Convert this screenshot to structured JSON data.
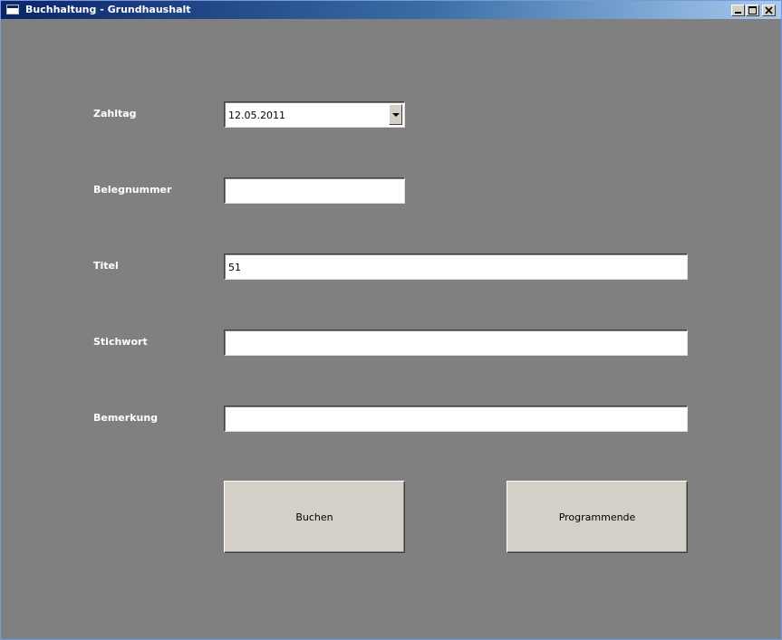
{
  "window": {
    "title": "Buchhaltung - Grundhaushalt"
  },
  "form": {
    "zahltag": {
      "label": "Zahltag",
      "value": "12.05.2011"
    },
    "belegnummer": {
      "label": "Belegnummer",
      "value": ""
    },
    "titel": {
      "label": "Titel",
      "value": "51"
    },
    "stichwort": {
      "label": "Stichwort",
      "value": ""
    },
    "bemerkung": {
      "label": "Bemerkung",
      "value": ""
    }
  },
  "buttons": {
    "buchen": "Buchen",
    "programmende": "Programmende"
  },
  "colors": {
    "background": "#808080",
    "button_face": "#d4d0c8",
    "titlebar_start": "#0a246a",
    "label_text": "#ffffff"
  },
  "icons": {
    "window": "app-window-icon",
    "minimize": "minimize-icon",
    "maximize": "maximize-icon",
    "close": "close-icon",
    "dropdown": "chevron-down-icon"
  }
}
